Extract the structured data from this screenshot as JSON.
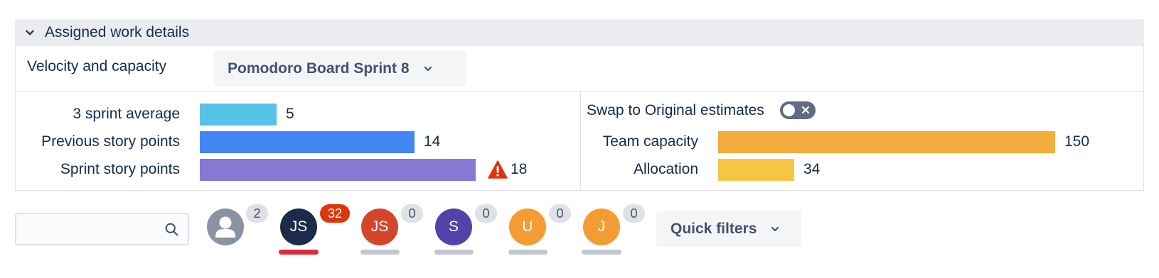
{
  "section": {
    "title": "Assigned work details",
    "icon": "chevron-down-icon"
  },
  "velocity": {
    "label": "Velocity and capacity",
    "sprint_select": "Pomodoro Board Sprint 8",
    "bars": [
      {
        "label": "3 sprint average",
        "value": "5",
        "num": 5,
        "color": "#56c3e6"
      },
      {
        "label": "Previous story points",
        "value": "14",
        "num": 14,
        "color": "#4286f4"
      },
      {
        "label": "Sprint story points",
        "value": "18",
        "num": 18,
        "color": "#8679d6",
        "warning": true
      }
    ]
  },
  "capacity": {
    "swap_label": "Swap to Original estimates",
    "swap_on": false,
    "bars": [
      {
        "label": "Team capacity",
        "value": "150",
        "num": 150,
        "color": "#f2ad3c"
      },
      {
        "label": "Allocation",
        "value": "34",
        "num": 34,
        "color": "#f6c642"
      }
    ]
  },
  "filters": {
    "search_placeholder": "",
    "avatars": [
      {
        "initials": "",
        "count": "2",
        "color": "#8993a4",
        "badge_color": "#dfe1e6",
        "badge_text_color": "#42526e",
        "underline": "none",
        "generic": true
      },
      {
        "initials": "JS",
        "count": "32",
        "color": "#1c2b4a",
        "badge_color": "#de350b",
        "badge_text_color": "#ffffff",
        "underline": "#de2b3a"
      },
      {
        "initials": "JS",
        "count": "0",
        "color": "#d4462a",
        "badge_color": "#dfe1e6",
        "badge_text_color": "#42526e",
        "underline": "#c1c7d0"
      },
      {
        "initials": "S",
        "count": "0",
        "color": "#5243aa",
        "badge_color": "#dfe1e6",
        "badge_text_color": "#42526e",
        "underline": "#c1c7d0"
      },
      {
        "initials": "U",
        "count": "0",
        "color": "#f49c34",
        "badge_color": "#dfe1e6",
        "badge_text_color": "#42526e",
        "underline": "#c1c7d0"
      },
      {
        "initials": "J",
        "count": "0",
        "color": "#f49c34",
        "badge_color": "#dfe1e6",
        "badge_text_color": "#42526e",
        "underline": "#c1c7d0"
      }
    ],
    "quick_filters": "Quick filters"
  }
}
